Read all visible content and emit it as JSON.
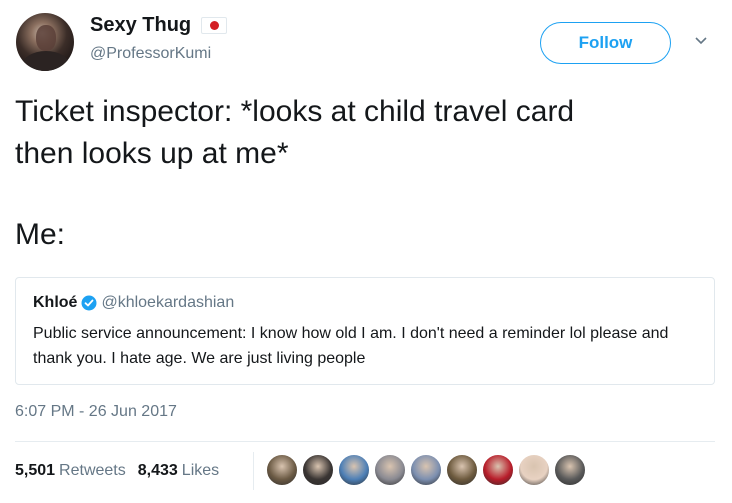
{
  "author": {
    "name": "Sexy Thug",
    "handle": "@ProfessorKumi",
    "flag_icon": "japan-flag-icon"
  },
  "follow_button": {
    "label": "Follow",
    "color": "#1da1f2"
  },
  "tweet": {
    "text_line1": "Ticket inspector: *looks at child travel card\nthen looks up at me*",
    "text_line2": "Me:"
  },
  "quoted_tweet": {
    "name": "Khloé",
    "verified_icon": "verified-badge-icon",
    "handle": "@khloekardashian",
    "text": "Public service announcement: I know how old I am. I don't need a reminder lol please and thank you. I hate age. We are just living people"
  },
  "timestamp": "6:07 PM - 26 Jun 2017",
  "stats": {
    "retweets_count": "5,501",
    "retweets_label": "Retweets",
    "likes_count": "8,433",
    "likes_label": "Likes"
  },
  "liker_avatars": [
    {
      "color": "#6b5a44"
    },
    {
      "color": "#3a3533"
    },
    {
      "color": "#4d7fb6"
    },
    {
      "color": "#8a8a92"
    },
    {
      "color": "#7c8fb0"
    },
    {
      "color": "#6d5a3e"
    },
    {
      "color": "#b81d2a"
    },
    {
      "color": "#e8d2c2"
    },
    {
      "color": "#5a5a5a"
    }
  ]
}
